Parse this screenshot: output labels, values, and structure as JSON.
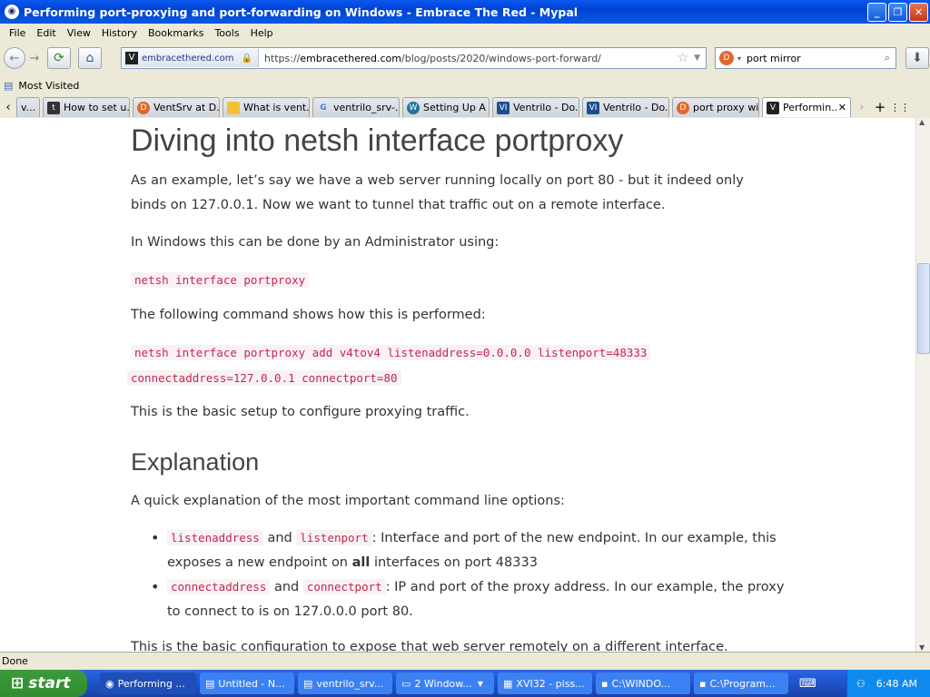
{
  "window": {
    "title": "Performing port-proxying and port-forwarding on Windows - Embrace The Red - Mypal"
  },
  "menu": [
    "File",
    "Edit",
    "View",
    "History",
    "Bookmarks",
    "Tools",
    "Help"
  ],
  "nav": {
    "site_label": "embracethered.com",
    "url_prefix": "https://",
    "url_domain": "embracethered.com",
    "url_path": "/blog/posts/2020/windows-port-forward/",
    "search_value": "port mirror"
  },
  "bookmarks": {
    "most_visited": "Most Visited"
  },
  "tabs": [
    "v...",
    "How to set u...",
    "VentSrv at D...",
    "What is vent...",
    "ventrilo_srv-...",
    "Setting Up A ...",
    "Ventrilo - Do...",
    "Ventrilo - Do...",
    "port proxy wi...",
    "Performin..."
  ],
  "article": {
    "h1": "Diving into netsh interface portproxy",
    "p1": "As an example, let’s say we have a web server running locally on port 80 - but it indeed only binds on 127.0.0.1. Now we want to tunnel that traffic out on a remote interface.",
    "p2": "In Windows this can be done by an Administrator using:",
    "code1": "netsh interface portproxy",
    "p3": "The following command shows how this is performed:",
    "code2a": "netsh interface portproxy add v4tov4 listenaddress=0.0.0.0 listenport=48333",
    "code2b": "connectaddress=127.0.0.1 connectport=80",
    "p4": "This is the basic setup to configure proxying traffic.",
    "h2": "Explanation",
    "p5": "A quick explanation of the most important command line options:",
    "li1_code_a": "listenaddress",
    "li1_and": "and",
    "li1_code_b": "listenport",
    "li1_text": ": Interface and port of the new endpoint. In our example, this exposes a new endpoint on ",
    "li1_bold": "all",
    "li1_tail": " interfaces on port 48333",
    "li2_code_a": "connectaddress",
    "li2_and": "and",
    "li2_code_b": "connectport",
    "li2_text": ": IP and port of the proxy address. In our example, the proxy to connect to is on 127.0.0.0 port 80.",
    "p6": "This is the basic configuration to expose that web server remotely on a different interface."
  },
  "status": "Done",
  "taskbar": {
    "start": "start",
    "tasks": [
      "Performing ...",
      "Untitled - N...",
      "ventrilo_srv...",
      "2 Window...",
      "XVI32 - piss...",
      "C:\\WINDO...",
      "C:\\Program..."
    ],
    "clock": "6:48 AM"
  }
}
